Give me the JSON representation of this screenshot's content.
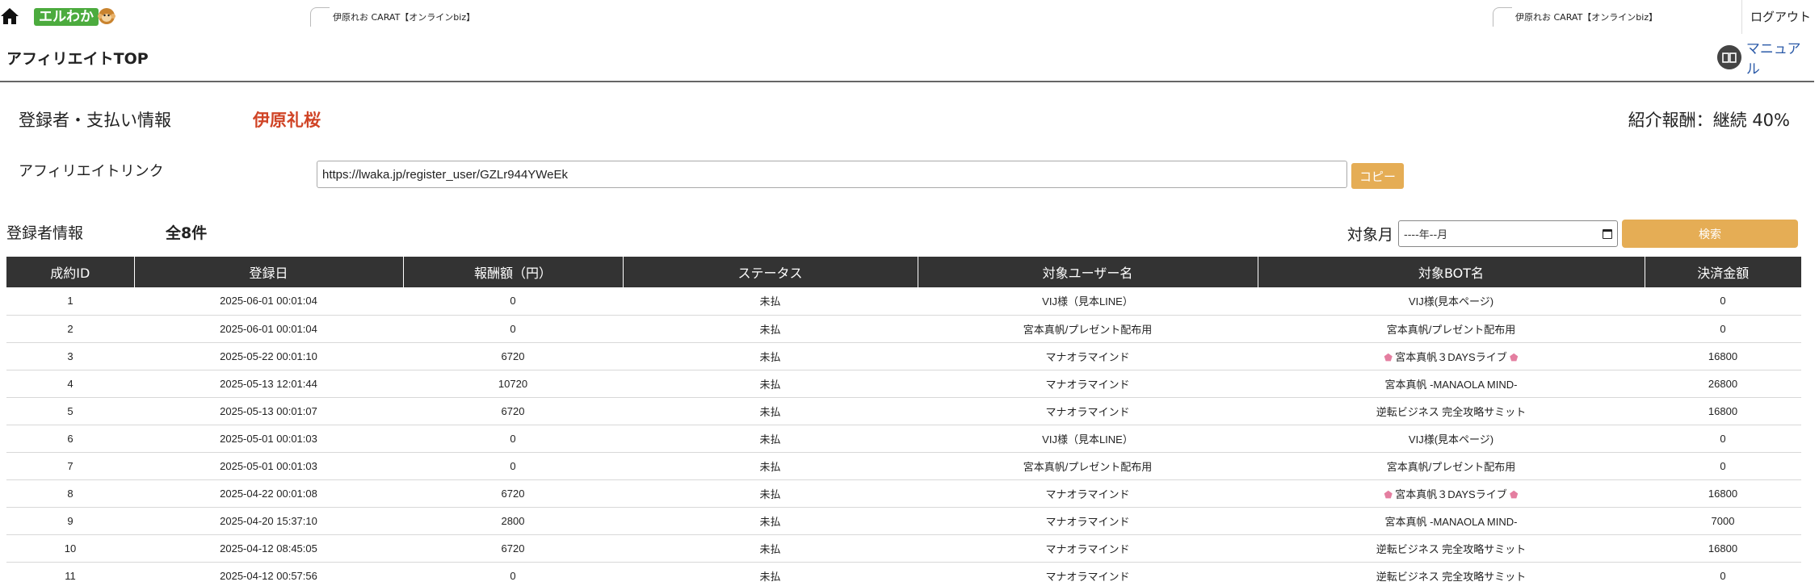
{
  "header": {
    "logo_text": "エルわか",
    "account_name": "伊原れお CARAT【オンラインbiz】",
    "logout_label": "ログアウト"
  },
  "subheader": {
    "page_title": "アフィリエイトTOP",
    "manual_label": "マニュアル"
  },
  "info": {
    "registrant_label": "登録者・支払い情報",
    "registrant_name": "伊原礼桜",
    "commission_text": "紹介報酬：継続 40%"
  },
  "affiliate": {
    "label": "アフィリエイトリンク",
    "url": "https://lwaka.jp/register_user/GZLr944YWeEk",
    "copy_label": "コピー"
  },
  "filter": {
    "section_label": "登録者情報",
    "count_text": "全8件",
    "month_label": "対象月",
    "month_placeholder": "----年--月",
    "search_label": "検索"
  },
  "table": {
    "headers": [
      "成約ID",
      "登録日",
      "報酬額（円）",
      "ステータス",
      "対象ユーザー名",
      "対象BOT名",
      "決済金額"
    ],
    "rows": [
      [
        "1",
        "2025-06-01 00:01:04",
        "0",
        "未払",
        "VIJ様（見本LINE）",
        "VIJ様(見本ページ)",
        "0"
      ],
      [
        "2",
        "2025-06-01 00:01:04",
        "0",
        "未払",
        "宮本真帆/プレゼント配布用",
        "宮本真帆/プレゼント配布用",
        "0"
      ],
      [
        "3",
        "2025-05-22 00:01:10",
        "6720",
        "未払",
        "マナオラマインド",
        "宮本真帆３DAYSライブ",
        "16800"
      ],
      [
        "4",
        "2025-05-13 12:01:44",
        "10720",
        "未払",
        "マナオラマインド",
        "宮本真帆 -MANAOLA MIND-",
        "26800"
      ],
      [
        "5",
        "2025-05-13 00:01:07",
        "6720",
        "未払",
        "マナオラマインド",
        "逆転ビジネス 完全攻略サミット",
        "16800"
      ],
      [
        "6",
        "2025-05-01 00:01:03",
        "0",
        "未払",
        "VIJ様（見本LINE）",
        "VIJ様(見本ページ)",
        "0"
      ],
      [
        "7",
        "2025-05-01 00:01:03",
        "0",
        "未払",
        "宮本真帆/プレゼント配布用",
        "宮本真帆/プレゼント配布用",
        "0"
      ],
      [
        "8",
        "2025-04-22 00:01:08",
        "6720",
        "未払",
        "マナオラマインド",
        "宮本真帆３DAYSライブ",
        "16800"
      ],
      [
        "9",
        "2025-04-20 15:37:10",
        "2800",
        "未払",
        "マナオラマインド",
        "宮本真帆 -MANAOLA MIND-",
        "7000"
      ],
      [
        "10",
        "2025-04-12 08:45:05",
        "6720",
        "未払",
        "マナオラマインド",
        "逆転ビジネス 完全攻略サミット",
        "16800"
      ],
      [
        "11",
        "2025-04-12 00:57:56",
        "0",
        "未払",
        "マナオラマインド",
        "逆転ビジネス 完全攻略サミット",
        "0"
      ]
    ],
    "flower_bot_rows": [
      2,
      7
    ]
  },
  "colors": {
    "accent": "#e5ad55",
    "header_dark": "#333333",
    "name_red": "#d04426",
    "link_blue": "#2b5aa8",
    "logo_green": "#4cab3e"
  }
}
